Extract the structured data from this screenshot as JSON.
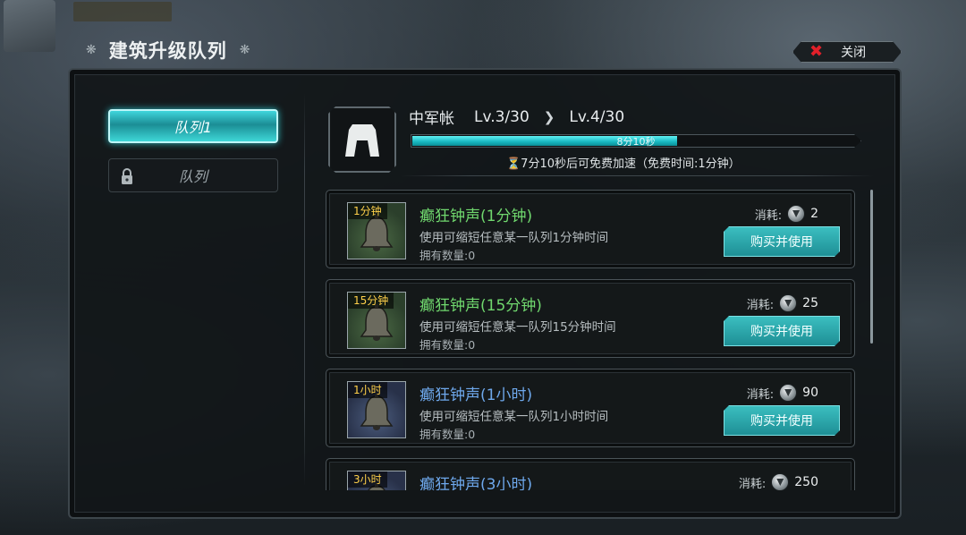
{
  "header": {
    "title": "建筑升级队列",
    "close_label": "关闭"
  },
  "queues": {
    "active_label": "队列1",
    "locked_label": "队列"
  },
  "building": {
    "name": "中军帐",
    "current_level": "Lv.3/30",
    "next_level": "Lv.4/30",
    "progress_text": "8分10秒",
    "progress_fraction": 0.59,
    "free_tip": "⏳7分10秒后可免费加速（免费时间:1分钟）"
  },
  "items": [
    {
      "tag": "1分钟",
      "name": "癫狂钟声(1分钟)",
      "desc": "使用可缩短任意某一队列1分钟时间",
      "owned": "拥有数量:0",
      "cost_label": "消耗:",
      "cost": "2",
      "button": "购买并使用",
      "color": "green"
    },
    {
      "tag": "15分钟",
      "name": "癫狂钟声(15分钟)",
      "desc": "使用可缩短任意某一队列15分钟时间",
      "owned": "拥有数量:0",
      "cost_label": "消耗:",
      "cost": "25",
      "button": "购买并使用",
      "color": "green"
    },
    {
      "tag": "1小时",
      "name": "癫狂钟声(1小时)",
      "desc": "使用可缩短任意某一队列1小时时间",
      "owned": "拥有数量:0",
      "cost_label": "消耗:",
      "cost": "90",
      "button": "购买并使用",
      "color": "blue"
    },
    {
      "tag": "3小时",
      "name": "癫狂钟声(3小时)",
      "desc": "",
      "owned": "",
      "cost_label": "消耗:",
      "cost": "250",
      "button": "",
      "color": "blue"
    }
  ],
  "colors": {
    "accent": "#2bb6bd",
    "close_x": "#e2202a",
    "green_name": "#70d86e",
    "blue_name": "#6ea8ec"
  }
}
